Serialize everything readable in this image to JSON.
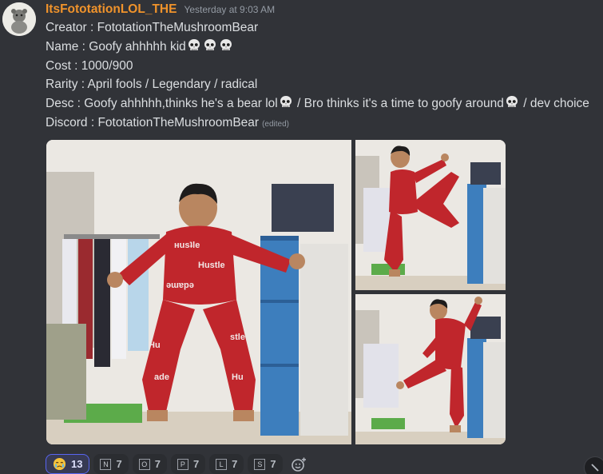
{
  "author": {
    "username": "ItsFototationLOL_THE",
    "timestamp": "Yesterday at 9:03 AM"
  },
  "message": {
    "creator": "Creator : FototationTheMushroomBear",
    "name": "Name : Goofy ahhhhh kid",
    "cost": "Cost : 1000/900",
    "rarity": "Rarity : April fools / Legendary / radical",
    "desc_part1": "Desc : Goofy ahhhhh,thinks he's a bear lol",
    "desc_part2": " / Bro thinks it's a time to goofy around",
    "desc_part3": " / dev choice",
    "discord": "Discord : FototationTheMushroomBear",
    "edited": "(edited)"
  },
  "attachments": [
    {
      "icon": "photo-kid-crouching"
    },
    {
      "icon": "photo-kid-kicking"
    },
    {
      "icon": "photo-kid-kicking-2"
    }
  ],
  "reactions": [
    {
      "icon": "crying-face-emoji",
      "count": "13"
    },
    {
      "letter": "N",
      "count": "7"
    },
    {
      "letter": "O",
      "count": "7"
    },
    {
      "letter": "P",
      "count": "7"
    },
    {
      "letter": "L",
      "count": "7"
    },
    {
      "letter": "S",
      "count": "7"
    }
  ],
  "colors": {
    "background": "#313338",
    "username": "#f0932b",
    "text": "#dbdee1",
    "muted": "#949ba4"
  }
}
